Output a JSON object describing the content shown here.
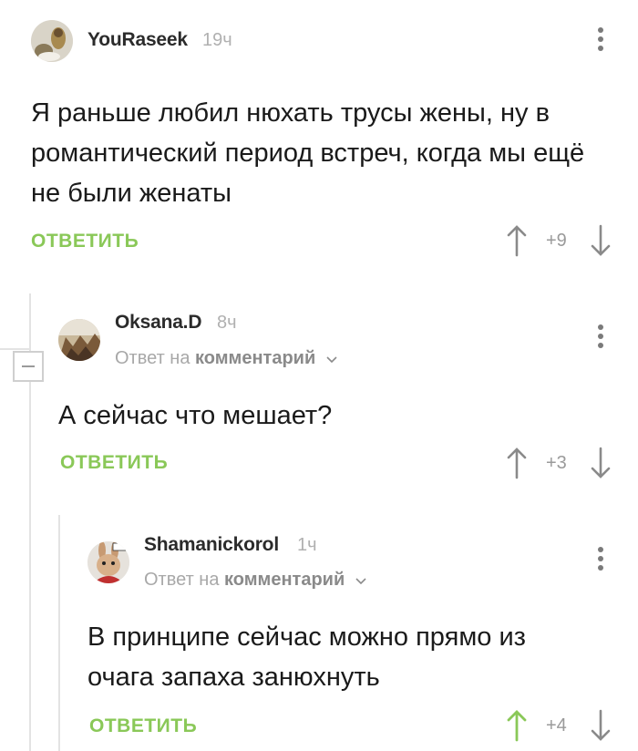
{
  "comments": [
    {
      "author": "YouRaseek",
      "time": "19ч",
      "text": "Я раньше любил нюхать трусы жены, ну в романтический период встреч, когда мы ещё не были женаты",
      "reply_label": "ОТВЕТИТЬ",
      "score": "+9",
      "menu_icon": "more-vertical-icon"
    },
    {
      "author": "Oksana.D",
      "time": "8ч",
      "reply_prefix": "Ответ на",
      "reply_target": "комментарий",
      "text": "А сейчас что мешает?",
      "reply_label": "ОТВЕТИТЬ",
      "score": "+3",
      "menu_icon": "more-vertical-icon"
    },
    {
      "author": "Shamanickorol",
      "time": "1ч",
      "reply_prefix": "Ответ на",
      "reply_target": "комментарий",
      "text": "В принципе сейчас можно прямо из очага запаха занюхнуть",
      "reply_label": "ОТВЕТИТЬ",
      "score": "+4",
      "upvoted": true,
      "menu_icon": "more-vertical-icon"
    }
  ],
  "colors": {
    "accent_green": "#8ac858",
    "vote_grey": "#8a8a8a",
    "thread_line": "#e3e3e3"
  }
}
